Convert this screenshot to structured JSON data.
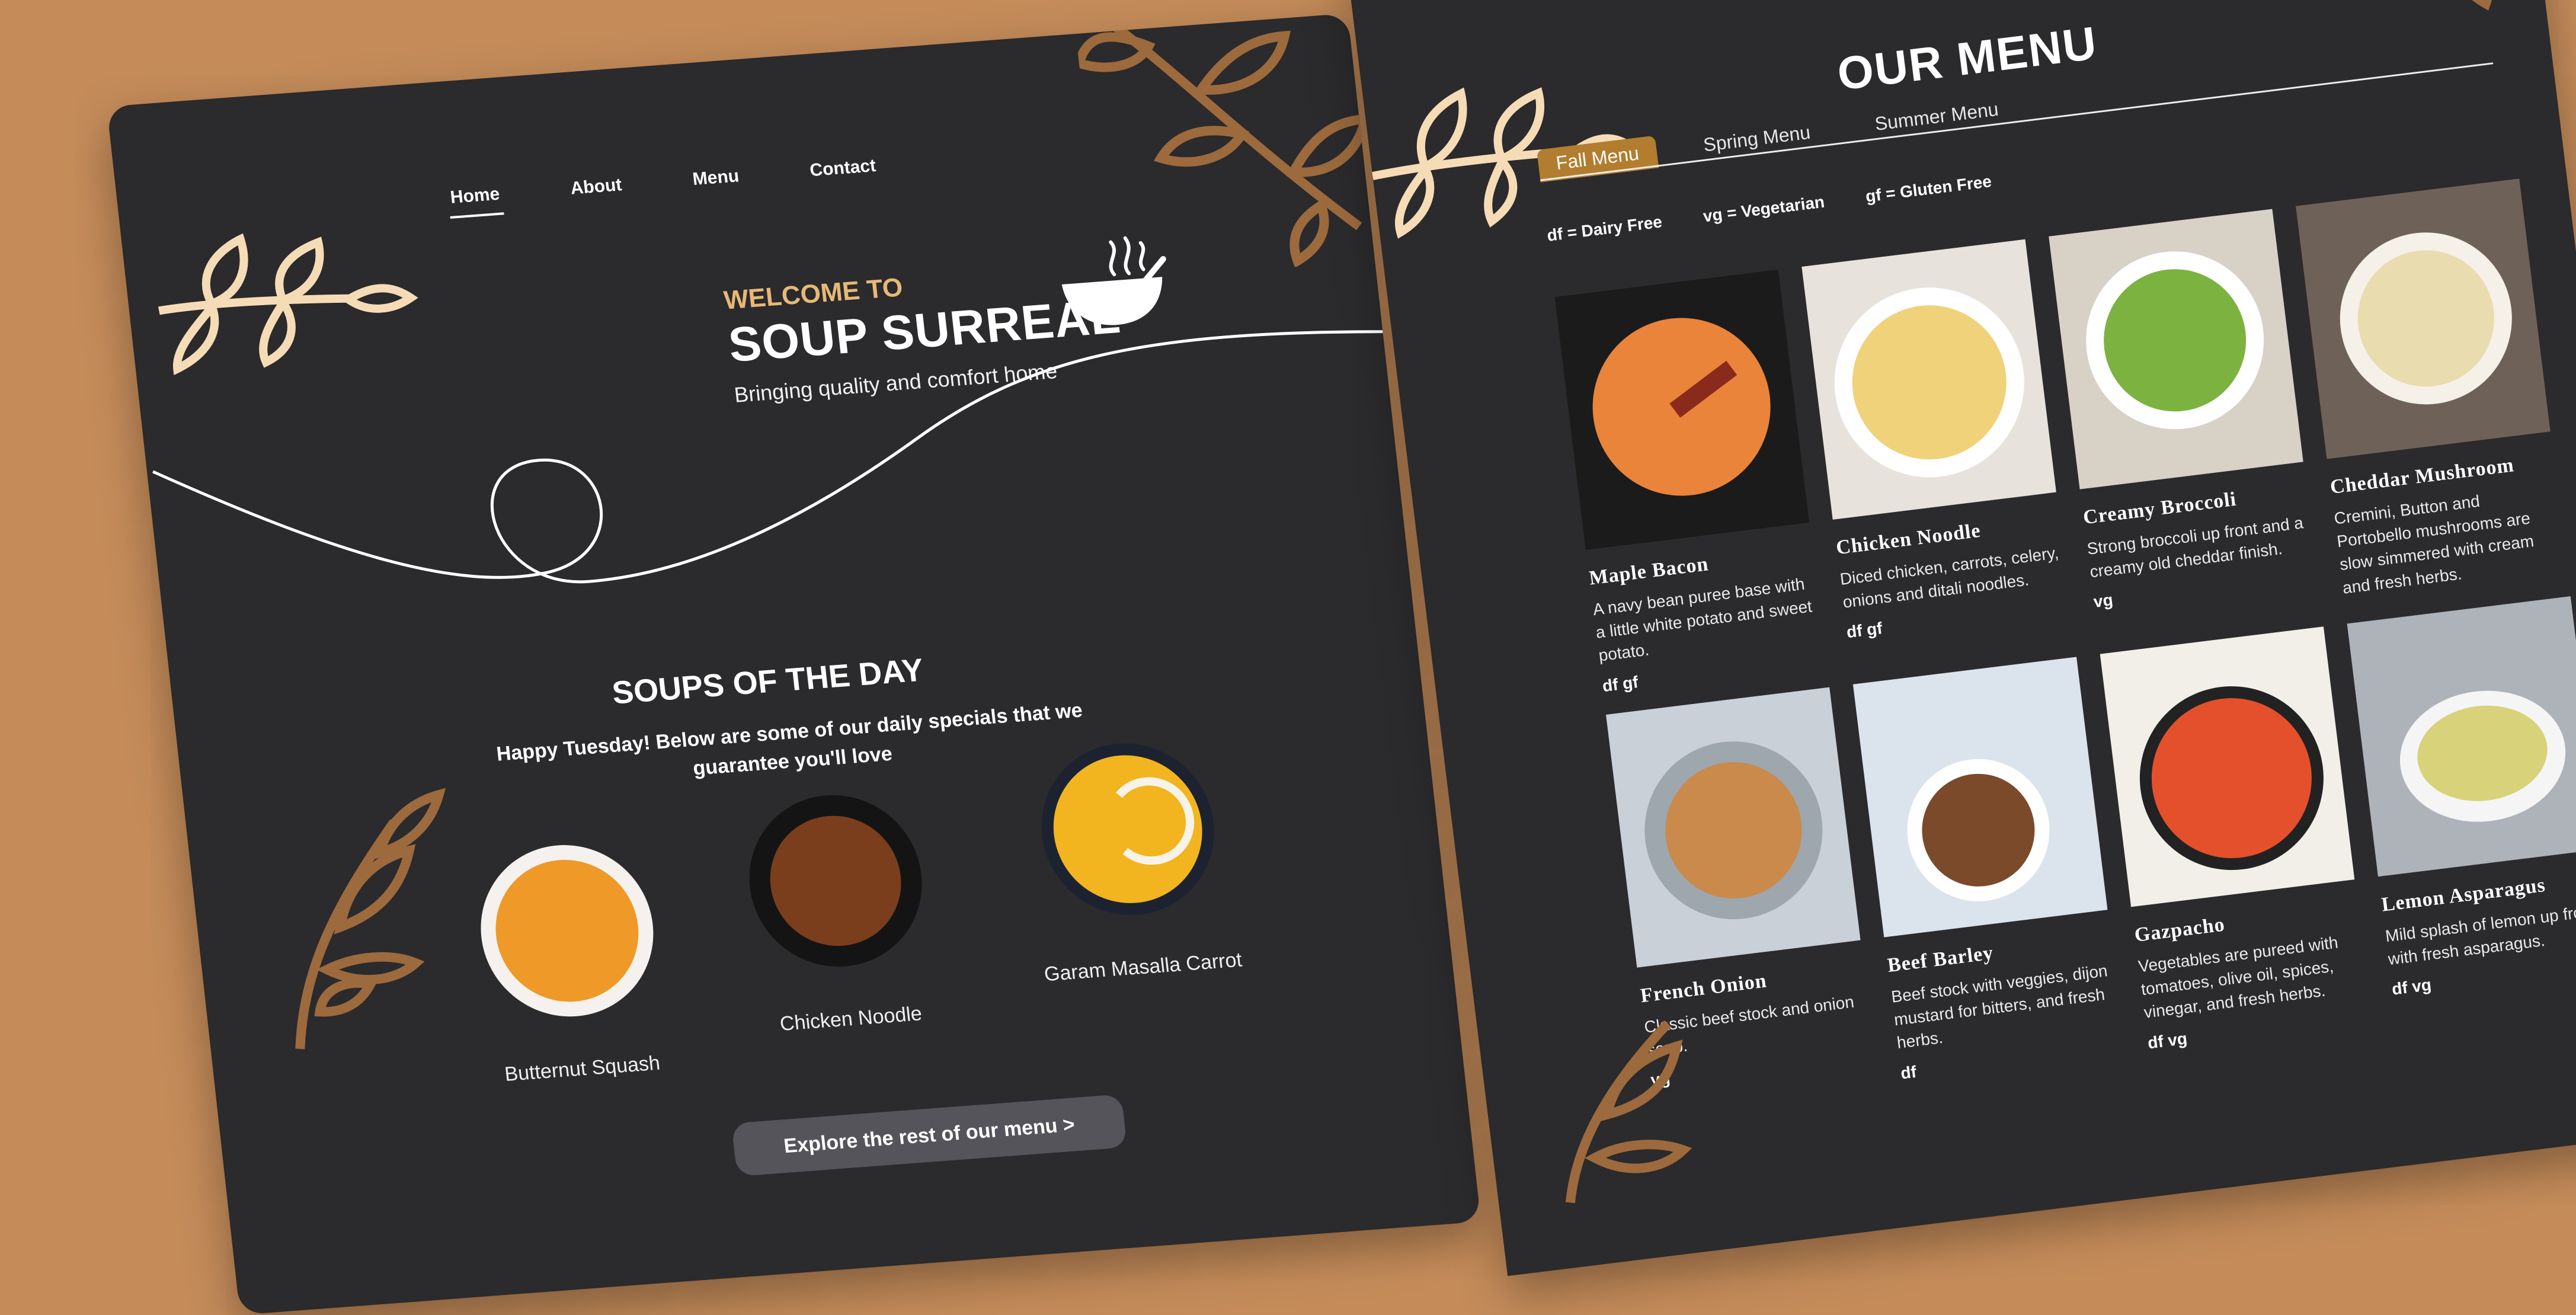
{
  "home": {
    "nav": [
      "Home",
      "About",
      "Menu",
      "Contact"
    ],
    "welcome_kicker": "WELCOME TO",
    "title": "SOUP SURREAL",
    "tagline": "Bringing quality and comfort home",
    "soups_title": "SOUPS OF THE DAY",
    "soups_subtitle": "Happy Tuesday! Below are some of our daily specials that we guarantee you'll love",
    "soups": [
      {
        "name": "Butternut Squash",
        "soup_color": "#ef9a28",
        "bowl_color": "#f4f1ee"
      },
      {
        "name": "Chicken Noodle",
        "soup_color": "#7a3e1c",
        "bowl_color": "#141414"
      },
      {
        "name": "Garam Masalla Carrot",
        "soup_color": "#f2b51f",
        "bowl_color": "#1c2230"
      }
    ],
    "cta": "Explore the rest of our menu >",
    "colors": {
      "accent": "#e6b977",
      "panel": "#2b2a2c",
      "background": "#c58c5a",
      "leaf_light": "#f6dcb6",
      "leaf_dark": "#9c6a3d"
    }
  },
  "menu": {
    "title": "OUR MENU",
    "tabs": [
      "Fall Menu",
      "Spring Menu",
      "Summer Menu"
    ],
    "active_tab": "Fall Menu",
    "legend": [
      "df = Dairy Free",
      "vg = Vegetarian",
      "gf = Gluten Free"
    ],
    "items": [
      {
        "name": "Maple Bacon",
        "desc": "A navy bean puree base with a little white potato and sweet potato.",
        "tags": "df  gf",
        "color": "#e9843a",
        "bg": "#1b1b1b"
      },
      {
        "name": "Chicken Noodle",
        "desc": "Diced chicken, carrots, celery, onions and ditali noodles.",
        "tags": "df  gf",
        "color": "#efd27a",
        "bg": "#e7e3dc"
      },
      {
        "name": "Creamy Broccoli",
        "desc": "Strong broccoli up front and a creamy old cheddar finish.",
        "tags": "vg",
        "color": "#7cb340",
        "bg": "#d7d1c6"
      },
      {
        "name": "Cheddar Mushroom",
        "desc": "Cremini, Button and Portobello mushrooms are slow simmered with cream and fresh herbs.",
        "tags": "",
        "color": "#e9dcae",
        "bg": "#6e6258"
      },
      {
        "name": "French Onion",
        "desc": "Classic beef stock and onion soup.",
        "tags": "vg",
        "color": "#c98a4b",
        "bg": "#c9d0d8"
      },
      {
        "name": "Beef Barley",
        "desc": "Beef stock with veggies, dijon mustard for bitters, and fresh herbs.",
        "tags": "df",
        "color": "#7a4a2a",
        "bg": "#dbe4ec"
      },
      {
        "name": "Gazpacho",
        "desc": "Vegetables are pureed with tomatoes, olive oil, spices, vinegar, and fresh herbs.",
        "tags": "df  vg",
        "color": "#e4502c",
        "bg": "#f2efe9"
      },
      {
        "name": "Lemon Asparagus",
        "desc": "Mild splash of lemon up front, with fresh asparagus.",
        "tags": "df  vg",
        "color": "#d8d27a",
        "bg": "#aeb3b9"
      }
    ]
  }
}
